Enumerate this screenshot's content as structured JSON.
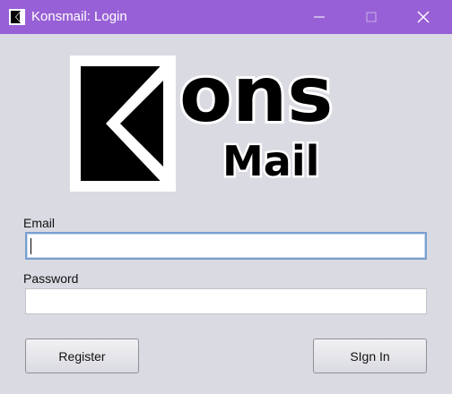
{
  "window": {
    "title": "Konsmail: Login",
    "controls": {
      "minimize": "minimize",
      "maximize": "maximize",
      "close": "close"
    }
  },
  "logo": {
    "word_top": "ons",
    "word_bottom": "Mail"
  },
  "form": {
    "email_label": "Email",
    "email_value": "",
    "password_label": "Password",
    "password_value": ""
  },
  "buttons": {
    "register_label": "Register",
    "signin_label": "SIgn In"
  },
  "colors": {
    "titlebar": "#9860d6",
    "background": "#d9dae2",
    "focus_border": "#7a9fce"
  }
}
